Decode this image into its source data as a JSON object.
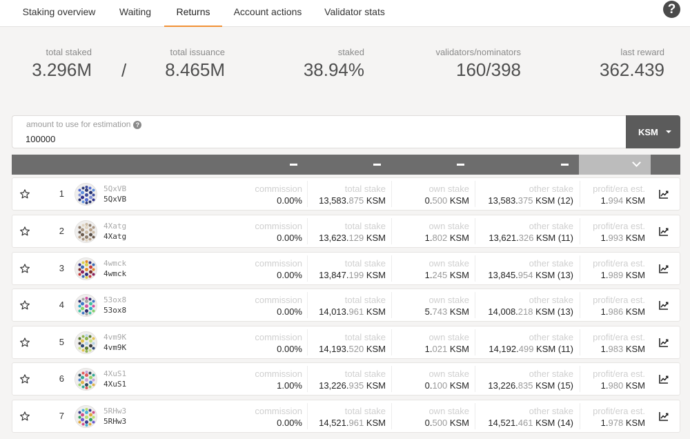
{
  "tabs": [
    {
      "label": "Staking overview",
      "active": false
    },
    {
      "label": "Waiting",
      "active": false
    },
    {
      "label": "Returns",
      "active": true
    },
    {
      "label": "Account actions",
      "active": false
    },
    {
      "label": "Validator stats",
      "active": false
    }
  ],
  "help_icon": "question-mark-circle-icon",
  "summary": {
    "total_staked": {
      "label": "total staked",
      "value": "3.296M"
    },
    "separator": "/",
    "total_issuance": {
      "label": "total issuance",
      "value": "8.465M"
    },
    "staked": {
      "label": "staked",
      "value": "38.94%"
    },
    "validators_nominators": {
      "label": "validators/nominators",
      "value": "160/398"
    },
    "last_reward": {
      "label": "last reward",
      "value": "362.439"
    }
  },
  "estimation": {
    "label": "amount to use for estimation",
    "value": "100000",
    "help_icon": "question-mark-circle-icon"
  },
  "unit_select": {
    "label": "KSM",
    "icon": "caret-down-icon"
  },
  "accent_color": "#f19135",
  "columns": {
    "commission": "commission",
    "total_stake": "total stake",
    "own_stake": "own stake",
    "other_stake": "other stake",
    "profit": "profit/era est."
  },
  "validators": [
    {
      "rank": "1",
      "addr1": "5QxVB",
      "addr2": "5QxVB",
      "commission": "0.00%",
      "total_main": "13,583.",
      "total_dec": "875",
      "total_unit": " KSM",
      "own_main": "0.",
      "own_dec": "500",
      "own_unit": " KSM",
      "other_main": "13,583.",
      "other_dec": "375",
      "other_unit": " KSM (12)",
      "profit_main": "1.",
      "profit_dec": "994",
      "profit_unit": " KSM"
    },
    {
      "rank": "2",
      "addr1": "4Xatg",
      "addr2": "4Xatg",
      "commission": "0.00%",
      "total_main": "13,623.",
      "total_dec": "129",
      "total_unit": " KSM",
      "own_main": "1.",
      "own_dec": "802",
      "own_unit": " KSM",
      "other_main": "13,621.",
      "other_dec": "326",
      "other_unit": " KSM (11)",
      "profit_main": "1.",
      "profit_dec": "993",
      "profit_unit": " KSM"
    },
    {
      "rank": "3",
      "addr1": "4wmck",
      "addr2": "4wmck",
      "commission": "0.00%",
      "total_main": "13,847.",
      "total_dec": "199",
      "total_unit": " KSM",
      "own_main": "1.",
      "own_dec": "245",
      "own_unit": " KSM",
      "other_main": "13,845.",
      "other_dec": "954",
      "other_unit": " KSM (13)",
      "profit_main": "1.",
      "profit_dec": "989",
      "profit_unit": " KSM"
    },
    {
      "rank": "4",
      "addr1": "53ox8",
      "addr2": "53ox8",
      "commission": "0.00%",
      "total_main": "14,013.",
      "total_dec": "961",
      "total_unit": " KSM",
      "own_main": "5.",
      "own_dec": "743",
      "own_unit": " KSM",
      "other_main": "14,008.",
      "other_dec": "218",
      "other_unit": " KSM (13)",
      "profit_main": "1.",
      "profit_dec": "986",
      "profit_unit": " KSM"
    },
    {
      "rank": "5",
      "addr1": "4vm9K",
      "addr2": "4vm9K",
      "commission": "0.00%",
      "total_main": "14,193.",
      "total_dec": "520",
      "total_unit": " KSM",
      "own_main": "1.",
      "own_dec": "021",
      "own_unit": " KSM",
      "other_main": "14,192.",
      "other_dec": "499",
      "other_unit": " KSM (11)",
      "profit_main": "1.",
      "profit_dec": "983",
      "profit_unit": " KSM"
    },
    {
      "rank": "6",
      "addr1": "4XuS1",
      "addr2": "4XuS1",
      "commission": "1.00%",
      "total_main": "13,226.",
      "total_dec": "935",
      "total_unit": " KSM",
      "own_main": "0.",
      "own_dec": "100",
      "own_unit": " KSM",
      "other_main": "13,226.",
      "other_dec": "835",
      "other_unit": " KSM (15)",
      "profit_main": "1.",
      "profit_dec": "980",
      "profit_unit": " KSM"
    },
    {
      "rank": "7",
      "addr1": "5RHw3",
      "addr2": "5RHw3",
      "commission": "0.00%",
      "total_main": "14,521.",
      "total_dec": "961",
      "total_unit": " KSM",
      "own_main": "0.",
      "own_dec": "500",
      "own_unit": " KSM",
      "other_main": "14,521.",
      "other_dec": "461",
      "other_unit": " KSM (14)",
      "profit_main": "1.",
      "profit_dec": "978",
      "profit_unit": " KSM"
    }
  ]
}
